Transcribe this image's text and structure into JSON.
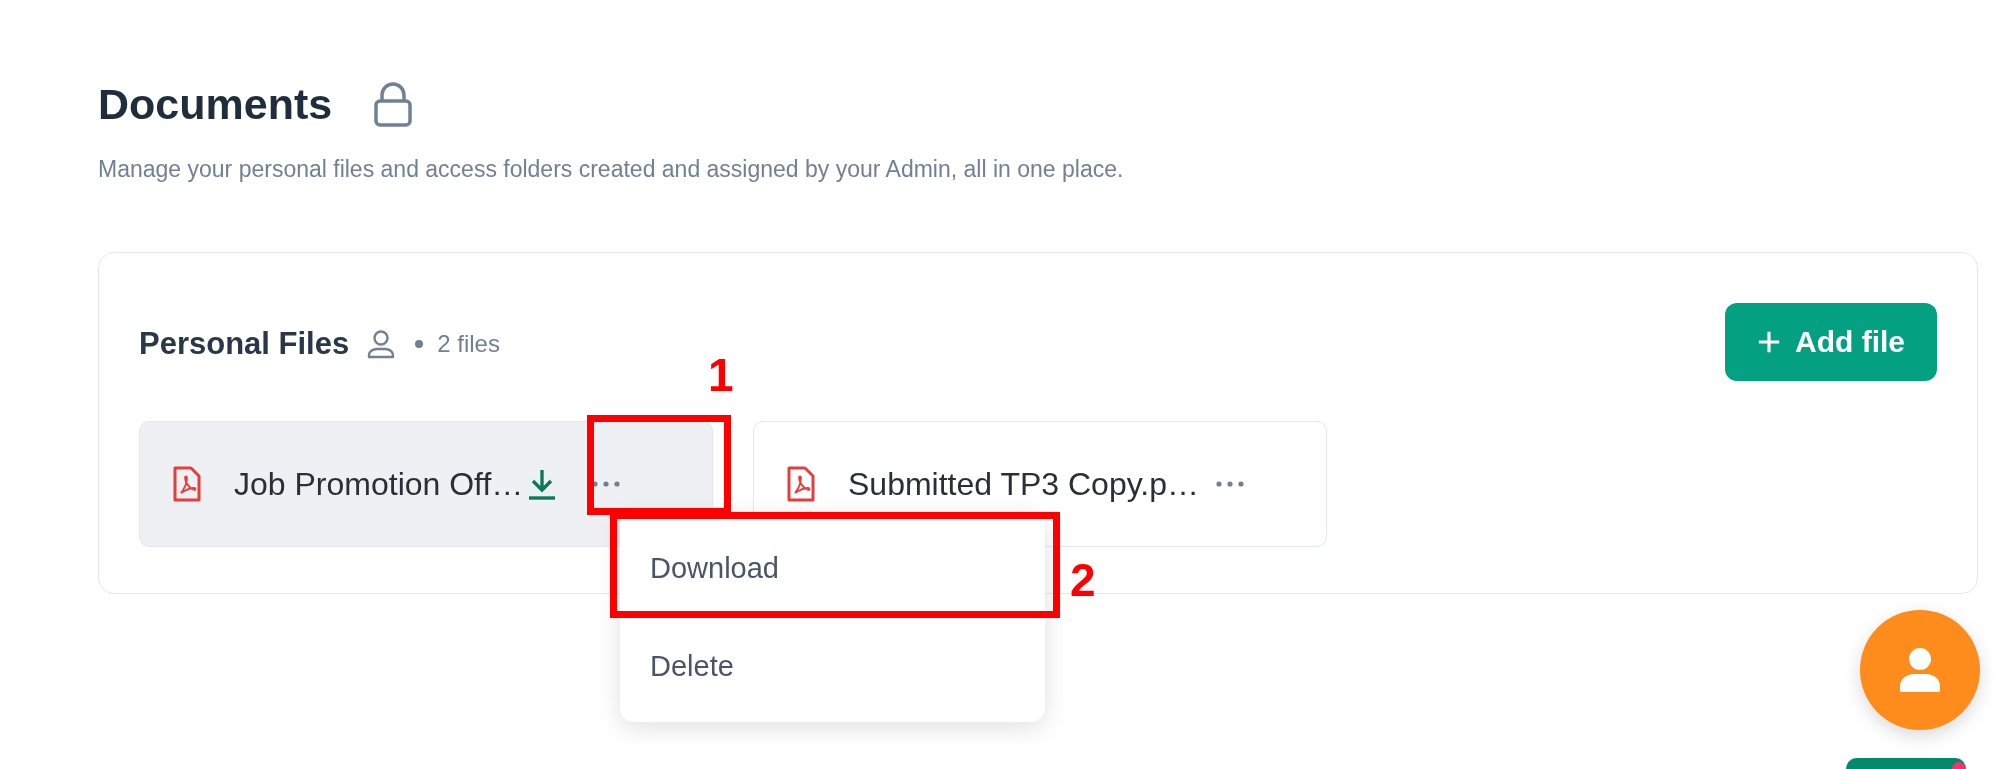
{
  "header": {
    "title": "Documents",
    "subtitle": "Manage your personal files and access folders created and assigned by your Admin, all in one place."
  },
  "section": {
    "title": "Personal Files",
    "count": "2 files",
    "add_button": "Add file",
    "files": [
      {
        "name": "Job Promotion Off…",
        "hovered": true
      },
      {
        "name": "Submitted TP3 Copy.p…",
        "hovered": false
      }
    ]
  },
  "menu": {
    "items": [
      {
        "label": "Download",
        "selected": false
      },
      {
        "label": "Delete",
        "selected": false
      }
    ]
  },
  "annotations": [
    {
      "label": "1",
      "kind": "box"
    },
    {
      "label": "2",
      "kind": "box"
    }
  ]
}
